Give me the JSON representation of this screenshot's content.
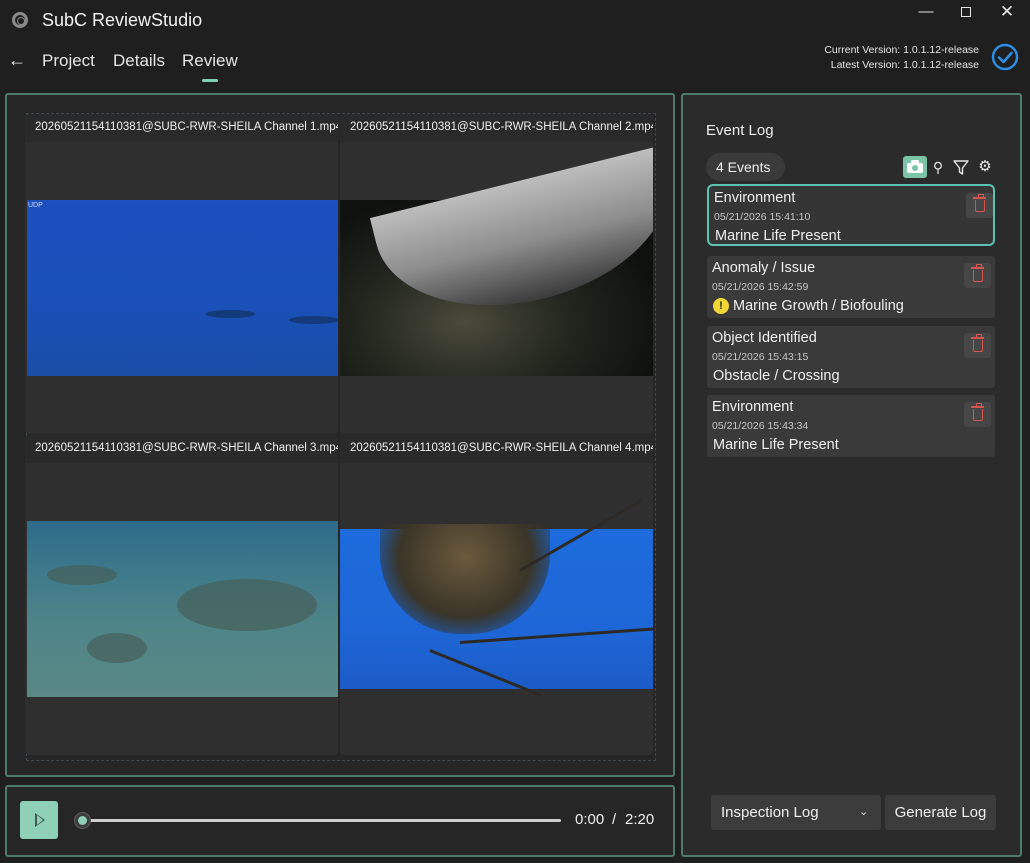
{
  "app": {
    "title": "SubC ReviewStudio",
    "icon": "gear-logo-icon",
    "window_controls": [
      "minimize",
      "maximize",
      "close"
    ]
  },
  "nav": {
    "back": "back-arrow-icon",
    "tabs": [
      {
        "label": "Project",
        "active": false
      },
      {
        "label": "Details",
        "active": false
      },
      {
        "label": "Review",
        "active": true
      }
    ]
  },
  "version": {
    "current": "Current Version: 1.0.1.12-release",
    "latest": "Latest Version: 1.0.1.12-release",
    "status_icon": "check-circle-icon"
  },
  "videos": [
    {
      "filename": "20260521154110381@SUBC-RWR-SHEILA Channel 1.mp4",
      "overlay": "UDP"
    },
    {
      "filename": "20260521154110381@SUBC-RWR-SHEILA Channel 2.mp4"
    },
    {
      "filename": "20260521154110381@SUBC-RWR-SHEILA Channel 3.mp4"
    },
    {
      "filename": "20260521154110381@SUBC-RWR-SHEILA Channel 4.mp4"
    }
  ],
  "playback": {
    "current": "0:00",
    "separator": "/",
    "duration": "2:20",
    "progress": 0.0
  },
  "event_log": {
    "title": "Event Log",
    "count_label": "4  Events",
    "toolbar": [
      "camera-icon",
      "key-icon",
      "filter-icon",
      "gear-icon"
    ],
    "events": [
      {
        "category": "Environment",
        "timestamp": "05/21/2026 15:41:10",
        "description": "Marine Life Present",
        "selected": true,
        "warning": false
      },
      {
        "category": "Anomaly / Issue",
        "timestamp": "05/21/2026 15:42:59",
        "description": "Marine Growth / Biofouling",
        "selected": false,
        "warning": true
      },
      {
        "category": "Object Identified",
        "timestamp": "05/21/2026 15:43:15",
        "description": "Obstacle / Crossing",
        "selected": false,
        "warning": false
      },
      {
        "category": "Environment",
        "timestamp": "05/21/2026 15:43:34",
        "description": "Marine Life Present",
        "selected": false,
        "warning": false
      }
    ],
    "log_type_selected": "Inspection Log",
    "generate_label": "Generate Log"
  },
  "colors": {
    "accent": "#8ed1b6",
    "panel_border": "#4e7b6c",
    "selected_border": "#5bc3b0",
    "delete": "#d9534f",
    "warning": "#f2d635",
    "check": "#2d8ee6"
  }
}
